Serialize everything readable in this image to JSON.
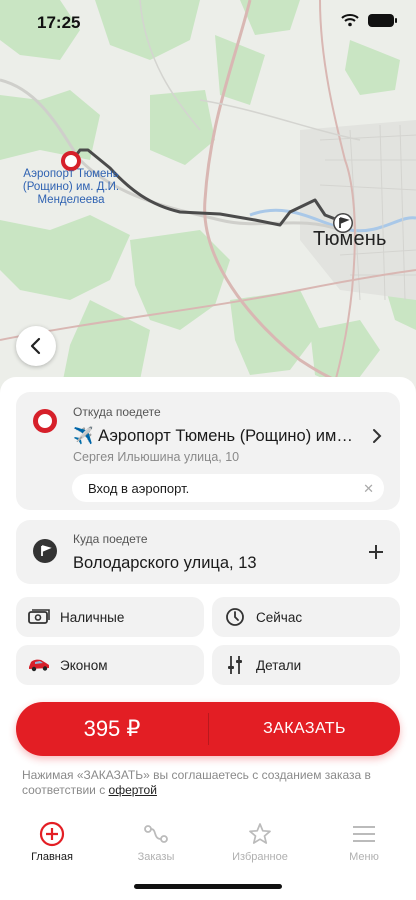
{
  "status_bar": {
    "time": "17:25"
  },
  "map": {
    "airport_label": "Аэропорт Тюмень (Рощино) им. Д.И. Менделеева",
    "city_label": "Тюмень"
  },
  "from": {
    "label": "Откуда поедете",
    "value": "✈️ Аэропорт Тюмень (Рощино) им…",
    "subtitle": "Сергея Ильюшина улица, 10",
    "entrance": "Вход в аэропорт."
  },
  "to": {
    "label": "Куда поедете",
    "value": "Володарского улица, 13"
  },
  "options": {
    "payment": "Наличные",
    "time": "Сейчас",
    "tariff": "Эконом",
    "details": "Детали"
  },
  "order": {
    "price": "395 ₽",
    "label": "ЗАКАЗАТЬ"
  },
  "legal": {
    "text": "Нажимая «ЗАКАЗАТЬ» вы соглашаетесь с созданием заказа в соответствии с ",
    "link": "офертой"
  },
  "tabs": [
    {
      "label": "Главная",
      "icon": "plus-circle-icon",
      "active": true
    },
    {
      "label": "Заказы",
      "icon": "route-icon",
      "active": false
    },
    {
      "label": "Избранное",
      "icon": "star-icon",
      "active": false
    },
    {
      "label": "Меню",
      "icon": "hamburger-icon",
      "active": false
    }
  ],
  "colors": {
    "accent": "#e31e24",
    "card": "#f2f2f2",
    "map": "#eceee9",
    "forest": "#c9e5c3"
  }
}
